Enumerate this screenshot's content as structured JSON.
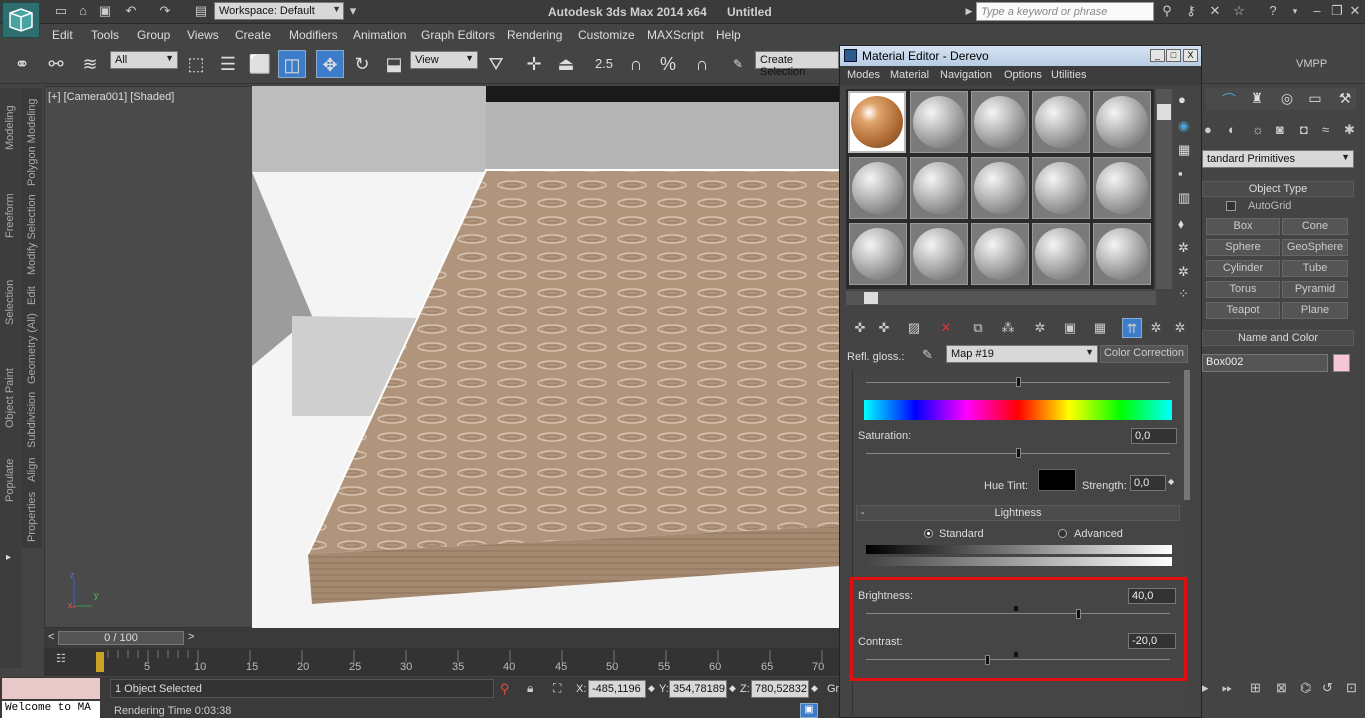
{
  "app": {
    "title": "Autodesk 3ds Max  2014 x64",
    "doc_name": "Untitled",
    "logo": "3ds-max-logo",
    "workspace": "Workspace: Default",
    "search_placeholder": "Type a keyword or phrase"
  },
  "menu": [
    "Edit",
    "Tools",
    "Group",
    "Views",
    "Create",
    "Modifiers",
    "Animation",
    "Graph Editors",
    "Rendering",
    "Customize",
    "MAXScript",
    "Help"
  ],
  "toolbar": {
    "filter": "All",
    "ref_coord": "View",
    "snap_angle": "2.5",
    "snap_percent": "%",
    "selection_set": "Create Selection",
    "vmpp": "VMPP"
  },
  "left_rail": [
    "Modeling",
    "Freeform",
    "Selection",
    "Object Paint",
    "Populate"
  ],
  "sub_rail": [
    "Polygon Modeling",
    "Modify Selection",
    "Edit",
    "Geometry (All)",
    "Subdivision",
    "Align",
    "Properties"
  ],
  "viewport": {
    "label": "[+] [Camera001] [Shaded]",
    "axis_x": "x",
    "axis_y": "y",
    "axis_z": "z"
  },
  "timeline": {
    "frame": "0 / 100",
    "ticks": [
      "5",
      "10",
      "15",
      "20",
      "25",
      "30",
      "35",
      "40",
      "45",
      "50",
      "55",
      "60",
      "65",
      "70"
    ],
    "left_arrow": "<",
    "right_arrow": ">"
  },
  "status": {
    "selected": "1 Object Selected",
    "render_time": "Rendering Time  0:03:38",
    "welcome": "Welcome to MA",
    "x_label": "X:",
    "x_value": "-485,1196",
    "y_label": "Y:",
    "y_value": "354,78189",
    "z_label": "Z:",
    "z_value": "780,52832",
    "grid_label": "Gr"
  },
  "command_panel": {
    "dropdown": "tandard Primitives",
    "object_type": "Object Type",
    "autogrid": "AutoGrid",
    "buttons": [
      "Box",
      "Cone",
      "Sphere",
      "GeoSphere",
      "Cylinder",
      "Tube",
      "Torus",
      "Pyramid",
      "Teapot",
      "Plane"
    ],
    "name_color": "Name and Color",
    "object_name": "Box002",
    "object_color": "#f5c6d6"
  },
  "material_editor": {
    "title": "Material Editor - Derevo",
    "menu": [
      "Modes",
      "Material",
      "Navigation",
      "Options",
      "Utilities"
    ],
    "map_label": "Refl. gloss.:",
    "map_name": "Map #19",
    "map_type": "Color Correction",
    "saturation_label": "Saturation:",
    "saturation_value": "0,0",
    "hue_tint_label": "Hue Tint:",
    "strength_label": "Strength:",
    "strength_value": "0,0",
    "lightness_rollout": "Lightness",
    "rollout_toggle": "-",
    "standard_label": "Standard",
    "advanced_label": "Advanced",
    "brightness_label": "Brightness:",
    "brightness_value": "40,0",
    "contrast_label": "Contrast:",
    "contrast_value": "-20,0",
    "close": "X",
    "minimize": "_",
    "maximize": "□"
  },
  "colors": {
    "highlight": "#e01010",
    "hue_tint": "#000000",
    "title_bar": "#c8d8ec"
  }
}
